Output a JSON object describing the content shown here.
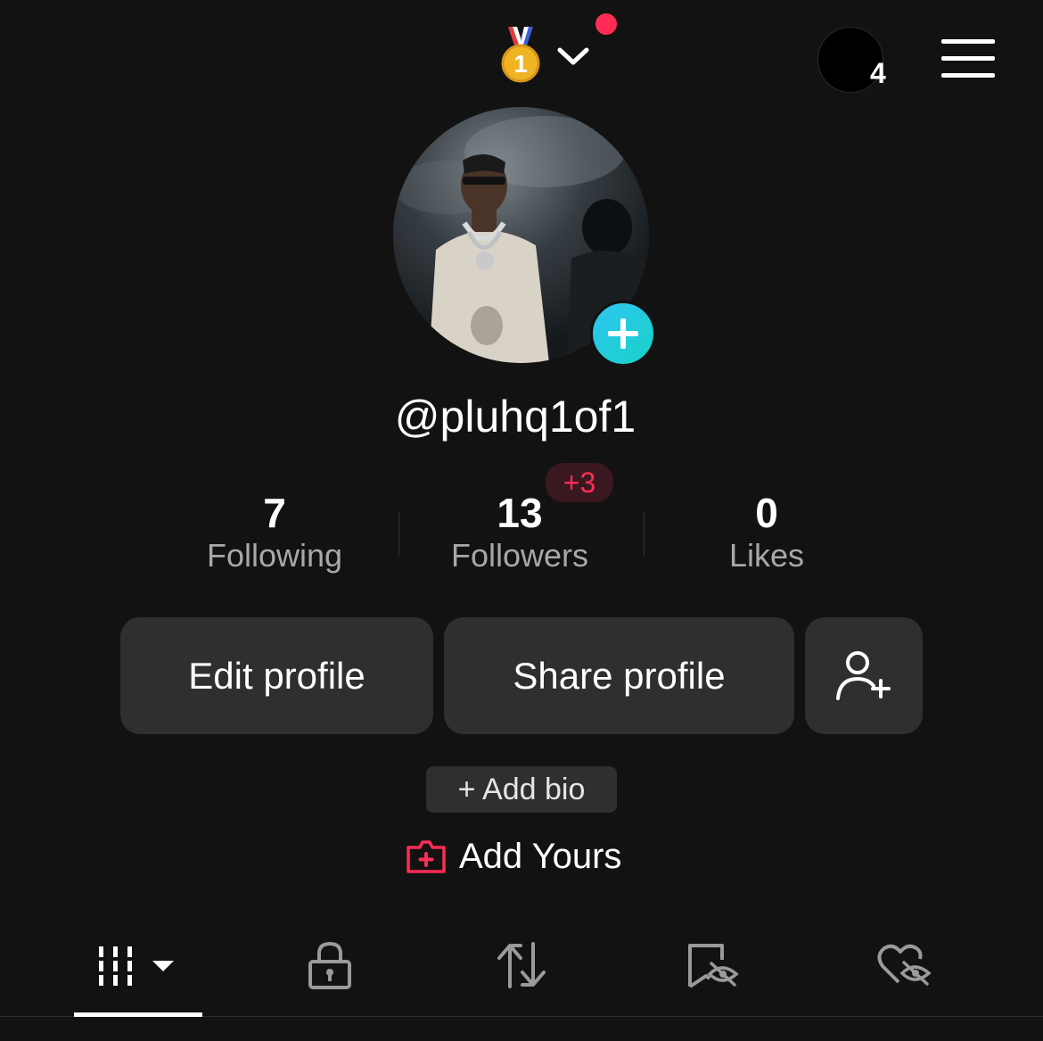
{
  "header": {
    "notifications_badge": "4",
    "medal_icon": "first-place-medal-icon",
    "dropdown_icon": "chevron-down-icon",
    "menu_icon": "hamburger-menu-icon",
    "accent": "#fe2c55"
  },
  "profile": {
    "username": "@pluhq1of1",
    "add_photo_icon": "plus-icon"
  },
  "stats": {
    "following": {
      "value": "7",
      "label": "Following"
    },
    "followers": {
      "value": "13",
      "label": "Followers",
      "badge": "+3"
    },
    "likes": {
      "value": "0",
      "label": "Likes"
    }
  },
  "actions": {
    "edit_label": "Edit profile",
    "share_label": "Share profile",
    "add_friend_icon": "add-friend-icon"
  },
  "bio": {
    "add_bio_label": "+ Add bio",
    "add_yours_label": "Add Yours"
  },
  "tabs": [
    {
      "id": "videos",
      "icon": "grid-dropdown-icon",
      "active": true
    },
    {
      "id": "private",
      "icon": "lock-icon",
      "active": false
    },
    {
      "id": "reposts",
      "icon": "repost-icon",
      "active": false
    },
    {
      "id": "favorites",
      "icon": "bookmark-hidden-icon",
      "active": false
    },
    {
      "id": "liked",
      "icon": "heart-hidden-icon",
      "active": false
    }
  ]
}
